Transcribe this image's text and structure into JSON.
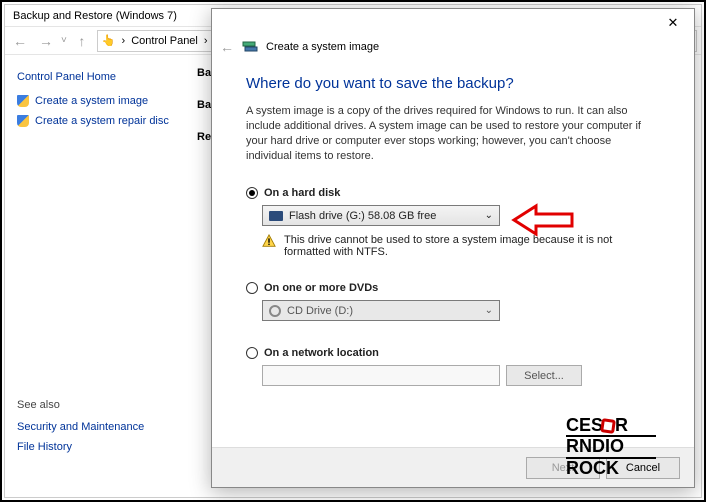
{
  "cp": {
    "title": "Backup and Restore (Windows 7)",
    "breadcrumb": "Control Panel",
    "home": "Control Panel Home",
    "links": [
      {
        "label": "Create a system image"
      },
      {
        "label": "Create a system repair disc"
      }
    ],
    "seealso_h": "See also",
    "seealso": [
      "Security and Maintenance",
      "File History"
    ],
    "crumb_a": "Ba",
    "crumb_b": "Ba",
    "crumb_c": "Re"
  },
  "dlg": {
    "title": "Create a system image",
    "question": "Where do you want to save the backup?",
    "desc": "A system image is a copy of the drives required for Windows to run. It can also include additional drives. A system image can be used to restore your computer if your hard drive or computer ever stops working; however, you can't choose individual items to restore.",
    "opt_disk": "On a hard disk",
    "disk_value": "Flash drive (G:)  58.08 GB free",
    "warn": "This drive cannot be used to store a system image because it is not formatted with NTFS.",
    "opt_dvd": "On one or more DVDs",
    "dvd_value": "CD Drive (D:)",
    "opt_net": "On a network location",
    "select_btn": "Select...",
    "next_btn": "Next",
    "cancel_btn": "Cancel"
  },
  "wm": {
    "l1": "CES",
    "l2": "RND",
    "l3": "ROCK",
    "tail": "IO",
    "r": "R"
  }
}
